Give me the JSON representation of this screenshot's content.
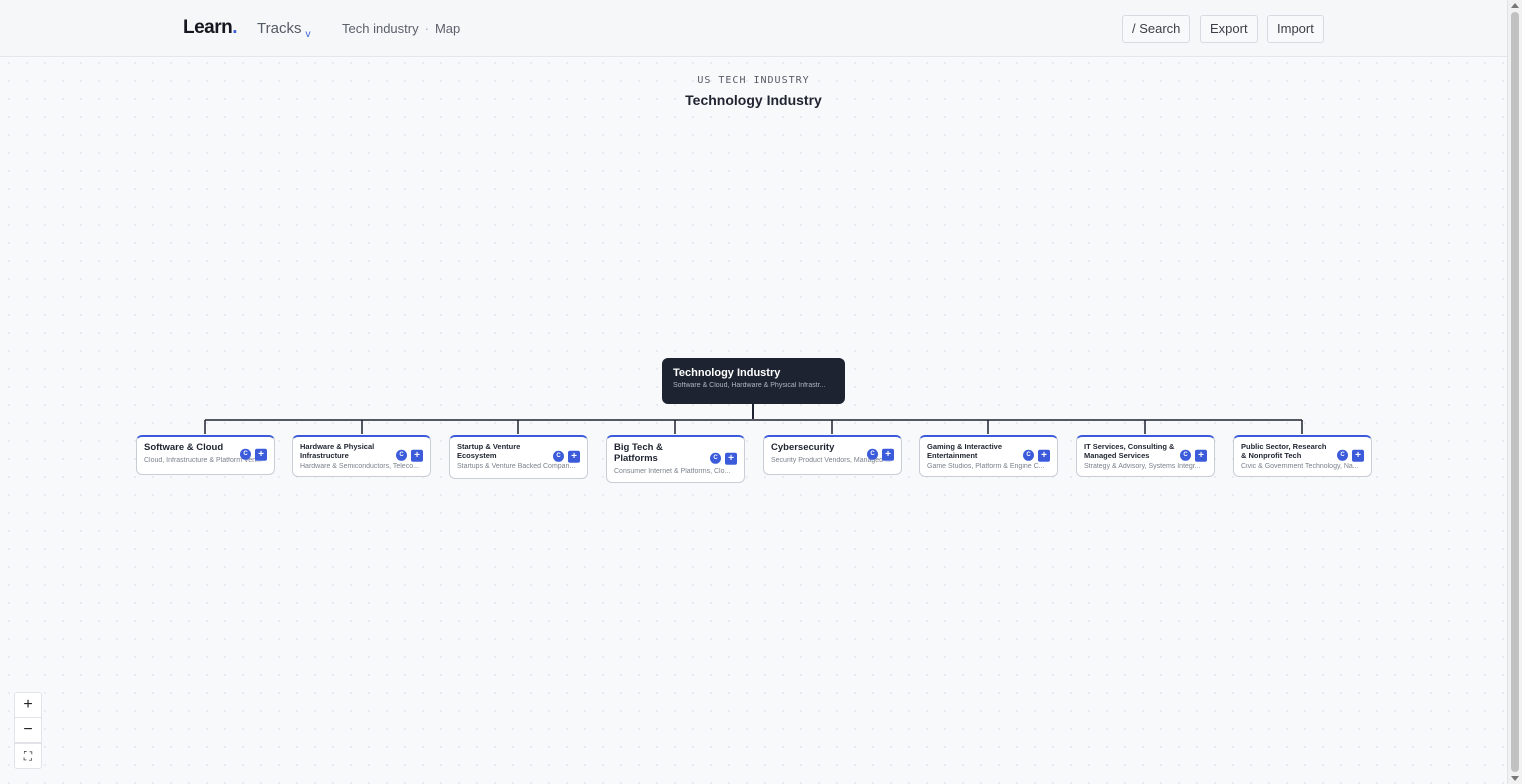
{
  "header": {
    "logo": "Learn",
    "logo_dot": ".",
    "tracks_label": "Tracks",
    "tracks_chevron": "v",
    "breadcrumb": [
      "Tech industry",
      "Map"
    ],
    "breadcrumb_sep": "·",
    "search_label": "/ Search",
    "export_label": "Export",
    "import_label": "Import"
  },
  "map": {
    "eyebrow": "US TECH INDUSTRY",
    "title": "Technology Industry",
    "root": {
      "title": "Technology Industry",
      "subtitle": "Software & Cloud, Hardware & Physical Infrastr..."
    },
    "children": [
      {
        "title": "Software & Cloud",
        "subtitle": "Cloud, Infrastructure & Platform Ven...",
        "badge": "C",
        "add": "+"
      },
      {
        "title": "Hardware & Physical Infrastructure",
        "subtitle": "Hardware & Semiconductors, Teleco...",
        "badge": "C",
        "add": "+"
      },
      {
        "title": "Startup & Venture Ecosystem",
        "subtitle": "Startups & Venture Backed Compan...",
        "badge": "C",
        "add": "+"
      },
      {
        "title": "Big Tech & Platforms",
        "subtitle": "Consumer Internet & Platforms, Clo...",
        "badge": "C",
        "add": "+"
      },
      {
        "title": "Cybersecurity",
        "subtitle": "Security Product Vendors, Managed ...",
        "badge": "C",
        "add": "+"
      },
      {
        "title": "Gaming & Interactive Entertainment",
        "subtitle": "Game Studios, Platform & Engine C...",
        "badge": "C",
        "add": "+"
      },
      {
        "title": "IT Services, Consulting & Managed Services",
        "subtitle": "Strategy & Advisory, Systems Integr...",
        "badge": "C",
        "add": "+"
      },
      {
        "title": "Public Sector, Research & Nonprofit Tech",
        "subtitle": "Civic & Government Technology, Na...",
        "badge": "C",
        "add": "+"
      }
    ]
  },
  "zoom": {
    "in_label": "+",
    "out_label": "−",
    "fit_label": "⛶"
  },
  "colors": {
    "accent": "#3b5bdb",
    "root_bg": "#1d2330"
  }
}
